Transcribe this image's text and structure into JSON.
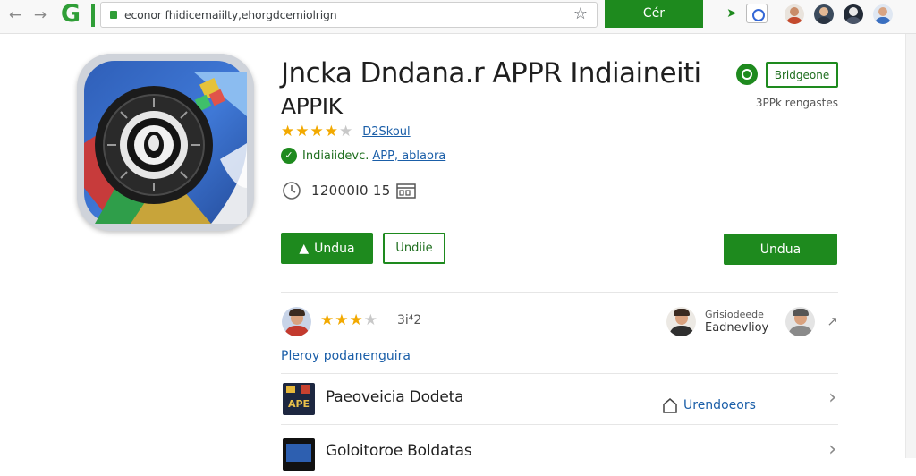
{
  "browser": {
    "url": "econor fhidicemaiilty,ehorgdcemiolrign",
    "green_button_label": "Cér",
    "icons": [
      "back-arrow-icon",
      "forward-arrow-icon",
      "bookmark-star-icon",
      "extension-arrow-icon",
      "extension-box-icon"
    ]
  },
  "app": {
    "title": "Jncka Dndana.r APPR Indiaineiti",
    "subtitle": "APPIK",
    "rating_stars": 4.5,
    "rating_link": "D2Skoul",
    "developer_name": "Indiaiidevc.",
    "developer_link": "APP, ablaora",
    "meta_text": "12000I0 15",
    "install_button": "Undua",
    "secondary_button": "Undiie",
    "right_button": "Undua",
    "colors": {
      "accent": "#1e8a1e",
      "link": "#1a5ea8",
      "star": "#f2a900"
    }
  },
  "badge": {
    "button_label": "Bridgeone",
    "note": "3PPk rengastes"
  },
  "review": {
    "stars": 3.5,
    "count": "3i⁴2",
    "reviewer_line1": "Grisiodeede",
    "reviewer_line2": "Eadnevlioy"
  },
  "section_link": "Pleroy podanenguira",
  "list": [
    {
      "title": "Paeoveicia Dodeta",
      "thumb_text": "APE",
      "action": "Urendoeors"
    },
    {
      "title": "Goloitoroe Boldatas"
    }
  ]
}
